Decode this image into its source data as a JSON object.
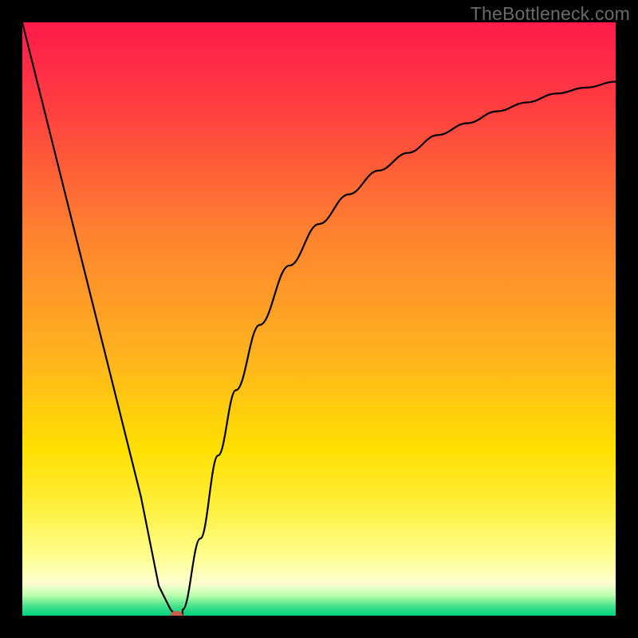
{
  "watermark": "TheBottleneck.com",
  "chart_data": {
    "type": "line",
    "title": "",
    "xlabel": "",
    "ylabel": "",
    "xlim": [
      0,
      100
    ],
    "ylim": [
      0,
      100
    ],
    "grid": false,
    "legend": false,
    "gradient_stops": [
      {
        "offset": 0.0,
        "color": "#ff1a4b"
      },
      {
        "offset": 0.15,
        "color": "#ff4040"
      },
      {
        "offset": 0.35,
        "color": "#ff8030"
      },
      {
        "offset": 0.55,
        "color": "#ffb020"
      },
      {
        "offset": 0.72,
        "color": "#ffe000"
      },
      {
        "offset": 0.82,
        "color": "#fff040"
      },
      {
        "offset": 0.9,
        "color": "#ffff90"
      },
      {
        "offset": 0.945,
        "color": "#ffffd0"
      },
      {
        "offset": 0.965,
        "color": "#c0ffb0"
      },
      {
        "offset": 0.985,
        "color": "#40e088"
      },
      {
        "offset": 1.0,
        "color": "#00d080"
      }
    ],
    "series": [
      {
        "name": "bottleneck-curve",
        "color": "#000000",
        "x": [
          0,
          5,
          10,
          15,
          20,
          23,
          25,
          26,
          27,
          30,
          33,
          36,
          40,
          45,
          50,
          55,
          60,
          65,
          70,
          75,
          80,
          85,
          90,
          95,
          100
        ],
        "values": [
          100,
          80,
          60,
          40,
          20,
          5,
          1,
          0,
          1,
          13,
          27,
          38,
          49,
          59,
          66,
          71,
          75,
          78,
          81,
          83,
          85,
          86.5,
          88,
          89,
          90
        ]
      }
    ],
    "marker": {
      "x": 26,
      "y": 0,
      "color": "#c86050",
      "rx": 8,
      "ry": 6
    }
  }
}
